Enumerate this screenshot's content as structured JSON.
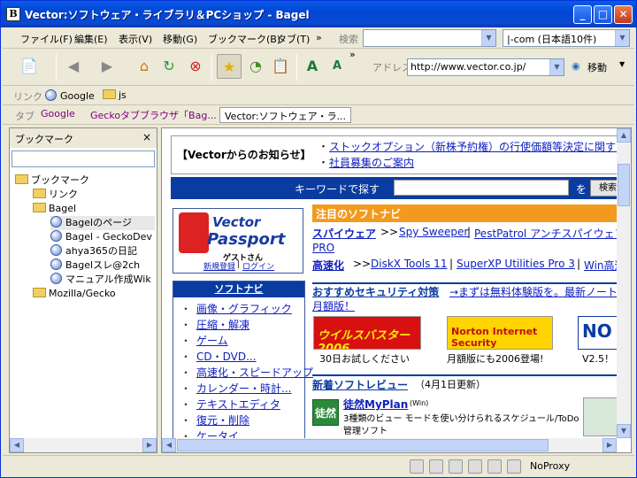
{
  "window": {
    "title": "Vector:ソフトウェア・ライブラリ＆PCショップ - Bagel",
    "app_icon": "B"
  },
  "menu": {
    "items": [
      "ファイル(F)",
      "編集(E)",
      "表示(V)",
      "移動(G)",
      "ブックマーク(B)",
      "タブ(T)"
    ],
    "overflow": "»",
    "search_label": "検索",
    "search_engine": "|-com (日本語10件)"
  },
  "toolbar": {
    "address_label": "アドレス",
    "address": "http://www.vector.co.jp/",
    "go_label": "移動",
    "overflow": "»"
  },
  "linkbar": {
    "label": "リンク",
    "items": [
      "Google",
      "js"
    ]
  },
  "tabbar": {
    "label": "タブ",
    "tabs": [
      "Google",
      "Geckoタブブラウザ「Bag...",
      "Vector:ソフトウェア・ラ..."
    ]
  },
  "sidebar": {
    "title": "ブックマーク",
    "close": "×",
    "tree": [
      "ブックマーク",
      "リンク",
      "Bagel",
      "Bagelのページ",
      "Bagel - GeckoDev",
      "ahya365の日記",
      "Bagelスレ@2ch",
      "マニュアル作成Wik",
      "Mozilla/Gecko"
    ]
  },
  "page": {
    "news_title": "【Vectorからのお知らせ】",
    "news": [
      "ストックオプション（新株予約権）の行使価額等決定に関する",
      "社員募集のご案内"
    ],
    "keyword_label": "キーワードで探す",
    "keyword_wo": "を",
    "keyword_btn": "検索",
    "passport": {
      "vector": "Vector",
      "passport": "Passport",
      "guest": "ゲストさん",
      "register": "新規登録",
      "login": "ログイン"
    },
    "navi_title": "注目のソフトナビ",
    "spyware": {
      "label": "スパイウェア",
      "arrows": ">>",
      "links": [
        "Spy Sweeper",
        "PestPatrol アンチスパイウェア",
        "PRO"
      ]
    },
    "speedup": {
      "label": "高速化",
      "arrows": ">>",
      "links": [
        "DiskX Tools 11",
        "SuperXP Utilities Pro 3",
        "Win高速"
      ]
    },
    "category_title": "ソフトナビ",
    "categories": [
      "画像・グラフィック",
      "圧縮・解凍",
      "ゲーム",
      "CD・DVD...",
      "高速化・スピードアップ",
      "カレンダー・時計...",
      "テキストエディタ",
      "復元・削除",
      "ケータイ"
    ],
    "security": {
      "title": "おすすめセキュリティ対策",
      "link": "→まずは無料体験版を。最新ノートン",
      "link2": "月額版！"
    },
    "banners": [
      {
        "name": "ウイルスバスター2006",
        "caption": "30日お試しください"
      },
      {
        "name": "Norton Internet Security",
        "caption": "月額版にも2006登場!"
      },
      {
        "name": "NO",
        "caption": "V2.5！"
      }
    ],
    "review": {
      "title": "新着ソフトレビュー",
      "date": "（4月1日更新）",
      "app": "徒然MyPlan",
      "os": "(Win)",
      "desc": "3種類のビュー モードを使い分けられるスケジュール/ToDo",
      "desc2": "管理ソフト",
      "badge": "徒然"
    }
  },
  "status": {
    "proxy": "NoProxy"
  }
}
